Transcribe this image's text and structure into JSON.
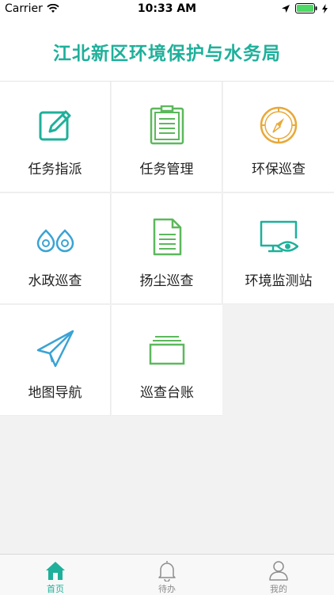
{
  "status_bar": {
    "carrier": "Carrier",
    "time": "10:33 AM"
  },
  "header": {
    "title": "江北新区环境保护与水务局"
  },
  "menu": [
    {
      "label": "任务指派",
      "icon": "edit-icon"
    },
    {
      "label": "任务管理",
      "icon": "clipboard-icon"
    },
    {
      "label": "环保巡查",
      "icon": "compass-icon"
    },
    {
      "label": "水政巡查",
      "icon": "water-drops-icon"
    },
    {
      "label": "扬尘巡查",
      "icon": "document-icon"
    },
    {
      "label": "环境监测站",
      "icon": "monitor-eye-icon"
    },
    {
      "label": "地图导航",
      "icon": "paper-plane-icon"
    },
    {
      "label": "巡查台账",
      "icon": "ledger-stack-icon"
    }
  ],
  "tabs": [
    {
      "label": "首页",
      "icon": "home-icon",
      "active": true
    },
    {
      "label": "待办",
      "icon": "bell-icon",
      "active": false
    },
    {
      "label": "我的",
      "icon": "user-icon",
      "active": false
    }
  ],
  "colors": {
    "accent": "#1eb09a",
    "icon_green": "#5cb85c",
    "icon_gold": "#e8a93a",
    "icon_blue": "#3aa3d4",
    "inactive_tab": "#8c8c8c"
  }
}
